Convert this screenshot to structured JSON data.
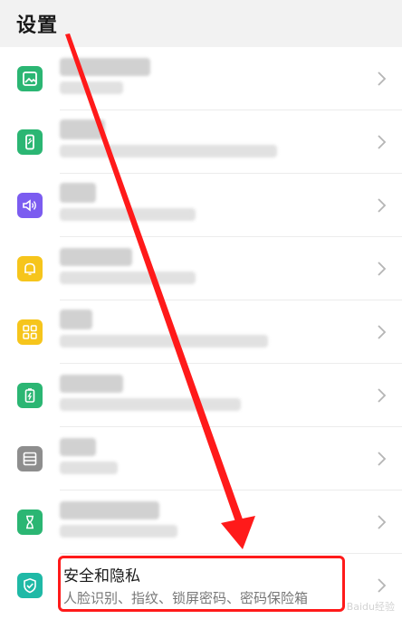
{
  "header": {
    "title": "设置"
  },
  "rows": [
    {
      "icon": "image-icon",
      "color": "#2bb673"
    },
    {
      "icon": "phone-icon",
      "color": "#2bb673"
    },
    {
      "icon": "speaker-icon",
      "color": "#7b5cf0"
    },
    {
      "icon": "bell-icon",
      "color": "#f6c51c"
    },
    {
      "icon": "grid-icon",
      "color": "#f6c51c"
    },
    {
      "icon": "battery-icon",
      "color": "#2bb673"
    },
    {
      "icon": "storage-icon",
      "color": "#8e8e8e"
    },
    {
      "icon": "hourglass-icon",
      "color": "#2bb673"
    },
    {
      "icon": "shield-icon",
      "color": "#1fb9a6",
      "title": "安全和隐私",
      "subtitle": "人脸识别、指纹、锁屏密码、密码保险箱"
    }
  ],
  "annotation": {
    "highlight_color": "#ff1a1a"
  },
  "watermark": "Baidu经验"
}
